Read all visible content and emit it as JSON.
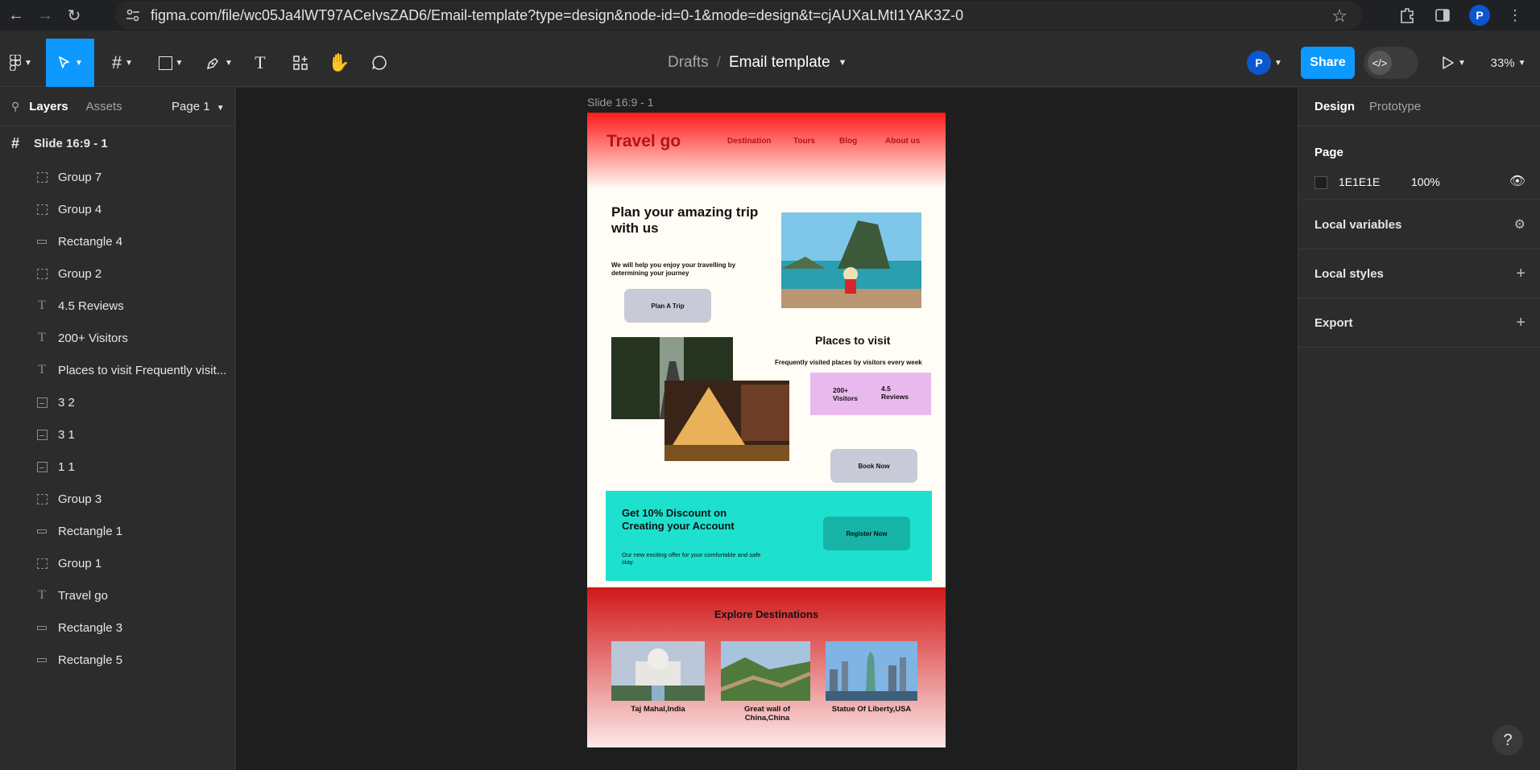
{
  "browser": {
    "url": "figma.com/file/wc05Ja4lWT97ACeIvsZAD6/Email-template?type=design&node-id=0-1&mode=design&t=cjAUXaLMtI1YAK3Z-0",
    "profile_initial": "P"
  },
  "toolbar": {
    "breadcrumb_root": "Drafts",
    "breadcrumb_sep": "/",
    "file_name": "Email template",
    "avatar_initial": "P",
    "share_label": "Share",
    "zoom": "33%"
  },
  "left_panel": {
    "tabs": [
      "Layers",
      "Assets"
    ],
    "page_selector": "Page 1",
    "root_frame": "Slide 16:9 - 1",
    "layers": [
      {
        "name": "Group 7",
        "icon": "group-icon"
      },
      {
        "name": "Group 4",
        "icon": "group-icon"
      },
      {
        "name": "Rectangle 4",
        "icon": "rectangle-icon"
      },
      {
        "name": "Group 2",
        "icon": "group-icon"
      },
      {
        "name": "4.5 Reviews",
        "icon": "text-icon"
      },
      {
        "name": "200+ Visitors",
        "icon": "text-icon"
      },
      {
        "name": "Places to visit Frequently visit...",
        "icon": "text-icon"
      },
      {
        "name": "3 2",
        "icon": "image-icon"
      },
      {
        "name": "3 1",
        "icon": "image-icon"
      },
      {
        "name": "1 1",
        "icon": "image-icon"
      },
      {
        "name": "Group 3",
        "icon": "group-icon"
      },
      {
        "name": "Rectangle 1",
        "icon": "rectangle-icon"
      },
      {
        "name": "Group 1",
        "icon": "group-icon"
      },
      {
        "name": "Travel go",
        "icon": "text-icon"
      },
      {
        "name": "Rectangle 3",
        "icon": "rectangle-icon"
      },
      {
        "name": "Rectangle 5",
        "icon": "rectangle-icon"
      }
    ]
  },
  "right_panel": {
    "tabs": [
      "Design",
      "Prototype"
    ],
    "page_section": "Page",
    "page_color": "1E1E1E",
    "page_opacity": "100%",
    "local_variables": "Local variables",
    "local_styles": "Local styles",
    "export": "Export"
  },
  "frame": {
    "label": "Slide 16:9 - 1",
    "brand": "Travel go",
    "nav": [
      "Destination",
      "Tours",
      "Blog",
      "About us"
    ],
    "hero_title": "Plan your amazing trip with us",
    "hero_sub": "We will help  you enjoy your travelling by determining your journey",
    "plan_btn": "Plan A Trip",
    "places_title": "Places to visit",
    "places_sub": "Frequently visited places by visitors every week",
    "stat_visitors": "200+ Visitors",
    "stat_reviews": "4.5 Reviews",
    "book_btn": "Book Now",
    "promo_title": "Get 10% Discount on Creating your Account",
    "promo_sub": "Our new exciting offer for your comfortable and safe stay.",
    "register_btn": "Register Now",
    "explore_title": "Explore Destinations",
    "destinations": [
      "Taj Mahal,India",
      "Great wall of China,China",
      "Statue Of Liberty,USA"
    ]
  },
  "colors": {
    "accent": "#0d99ff",
    "brand_red": "#b5121b",
    "promo_teal": "#1ee0cf"
  }
}
